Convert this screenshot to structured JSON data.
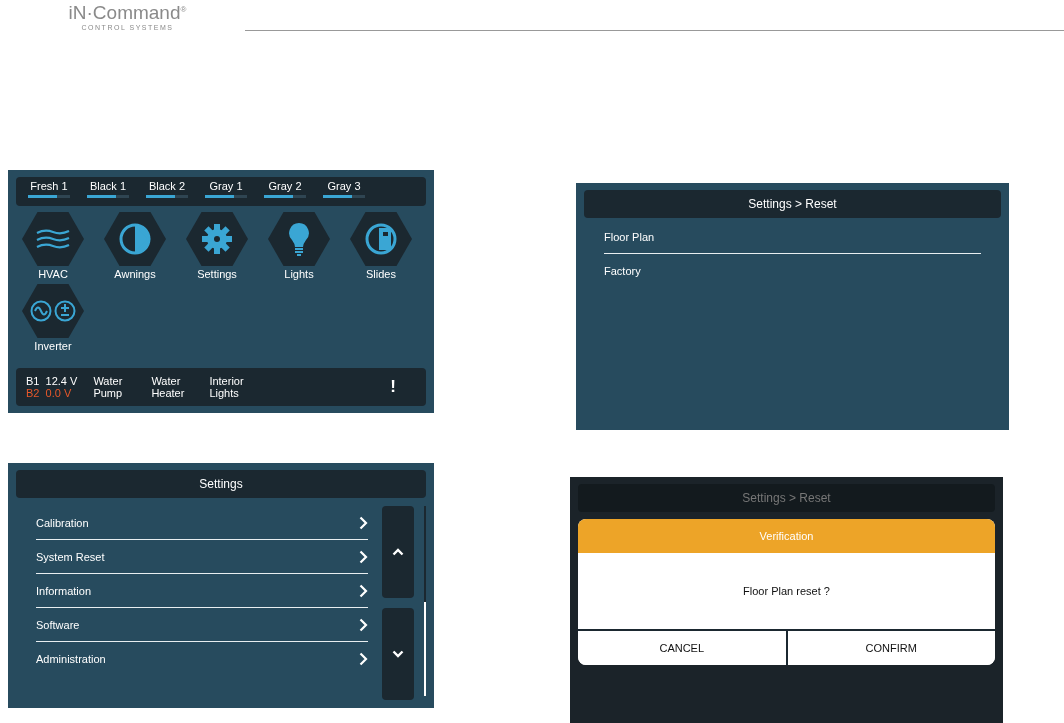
{
  "logo": {
    "brand": "iN·Command$^{®}$",
    "tagline": "CONTROL SYSTEMS"
  },
  "home_screen": {
    "tanks": [
      {
        "label": "Fresh 1",
        "level": 0.68
      },
      {
        "label": "Black 1",
        "level": 0.68
      },
      {
        "label": "Black 2",
        "level": 0.68
      },
      {
        "label": "Gray 1",
        "level": 0.68
      },
      {
        "label": "Gray 2",
        "level": 0.68
      },
      {
        "label": "Gray 3",
        "level": 0.68
      }
    ],
    "apps": [
      {
        "kind": "hvac",
        "label": "HVAC"
      },
      {
        "kind": "awnings",
        "label": "Awnings"
      },
      {
        "kind": "settings",
        "label": "Settings"
      },
      {
        "kind": "lights",
        "label": "Lights"
      },
      {
        "kind": "slides",
        "label": "Slides"
      },
      {
        "kind": "inverter",
        "label": "Inverter"
      }
    ],
    "batteries": [
      {
        "label": "B1",
        "reading": "12.4 V",
        "color": "#ffffff"
      },
      {
        "label": "B2",
        "reading": "0.0 V",
        "color": "#e8582a"
      }
    ],
    "switches": [
      "Water\nPump",
      "Water\nHeater",
      "Interior\nLights"
    ],
    "alert": "!"
  },
  "settings_screen": {
    "title": "Settings",
    "items": [
      "Calibration",
      "System Reset",
      "Information",
      "Software",
      "Administration"
    ]
  },
  "reset_screen": {
    "title": "Settings > Reset",
    "items": [
      "Floor Plan",
      "Factory"
    ]
  },
  "verify_screen": {
    "title": "Settings > Reset",
    "dialog": {
      "title": "Verification",
      "message": "Floor Plan reset ?",
      "buttons": [
        "CANCEL",
        "CONFIRM"
      ]
    }
  }
}
